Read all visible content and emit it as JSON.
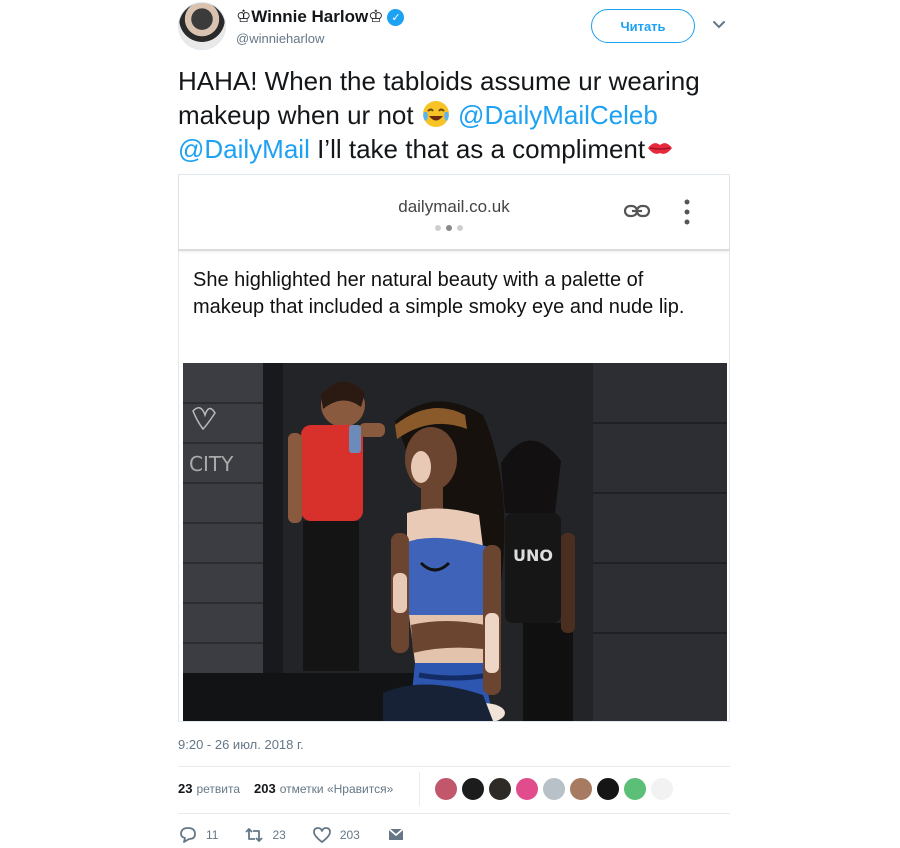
{
  "user": {
    "display_name": "♔Winnie Harlow♔",
    "handle": "@winnieharlow",
    "verified_icon": "verified-badge-icon",
    "follow_label": "Читать"
  },
  "tweet": {
    "text_part1": "HAHA! When the tabloids assume ur wearing makeup when ur not ",
    "emoji1": "face-with-tears-of-joy",
    "mention1": "@DailyMailCeleb",
    "mention2": "@DailyMail",
    "text_part2": " I’ll take that as a compliment",
    "emoji2": "kiss-mark"
  },
  "card": {
    "domain": "dailymail.co.uk",
    "caption": "She highlighted her natural beauty with a palette of makeup that included a simple smoky eye and nude lip."
  },
  "meta": {
    "timestamp": "9:20 - 26 июл. 2018 г.",
    "retweets_count": "23",
    "retweets_label": "ретвита",
    "likes_count": "203",
    "likes_label": "отметки «Нравится»"
  },
  "actions": {
    "reply_count": "11",
    "retweet_count": "23",
    "like_count": "203"
  },
  "colors": {
    "accent": "#1da1f2",
    "muted": "#657786"
  }
}
